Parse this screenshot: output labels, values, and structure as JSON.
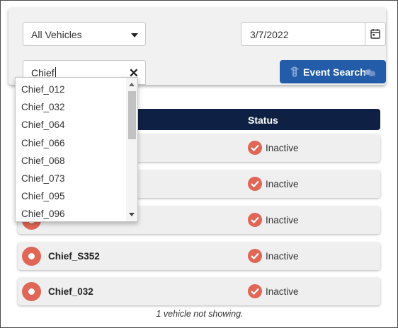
{
  "filters": {
    "vehicle_select_value": "All Vehicles",
    "date_value": "3/7/2022",
    "search_value": "Chief",
    "event_search_label": "Event Search"
  },
  "dropdown": {
    "items": [
      "Chief_012",
      "Chief_032",
      "Chief_064",
      "Chief_066",
      "Chief_068",
      "Chief_073",
      "Chief_095",
      "Chief_096"
    ]
  },
  "table": {
    "status_header": "Status",
    "rows": [
      {
        "name": "",
        "status": "Inactive"
      },
      {
        "name": "",
        "status": "Inactive"
      },
      {
        "name": "",
        "status": "Inactive"
      },
      {
        "name": "Chief_S352",
        "status": "Inactive"
      },
      {
        "name": "Chief_032",
        "status": "Inactive"
      }
    ]
  },
  "footer_note": "1 vehicle not showing.",
  "colors": {
    "primary_button": "#235ca8",
    "header_bg": "#0e2144",
    "status_red": "#e06655"
  },
  "icons": {
    "select_caret": "chevron-down-icon",
    "calendar": "calendar-icon",
    "clear": "close-icon",
    "event_left": "traffic-light-icon",
    "event_right": "car-crash-icon",
    "row_marker": "record-icon",
    "status": "check-circle-icon"
  }
}
